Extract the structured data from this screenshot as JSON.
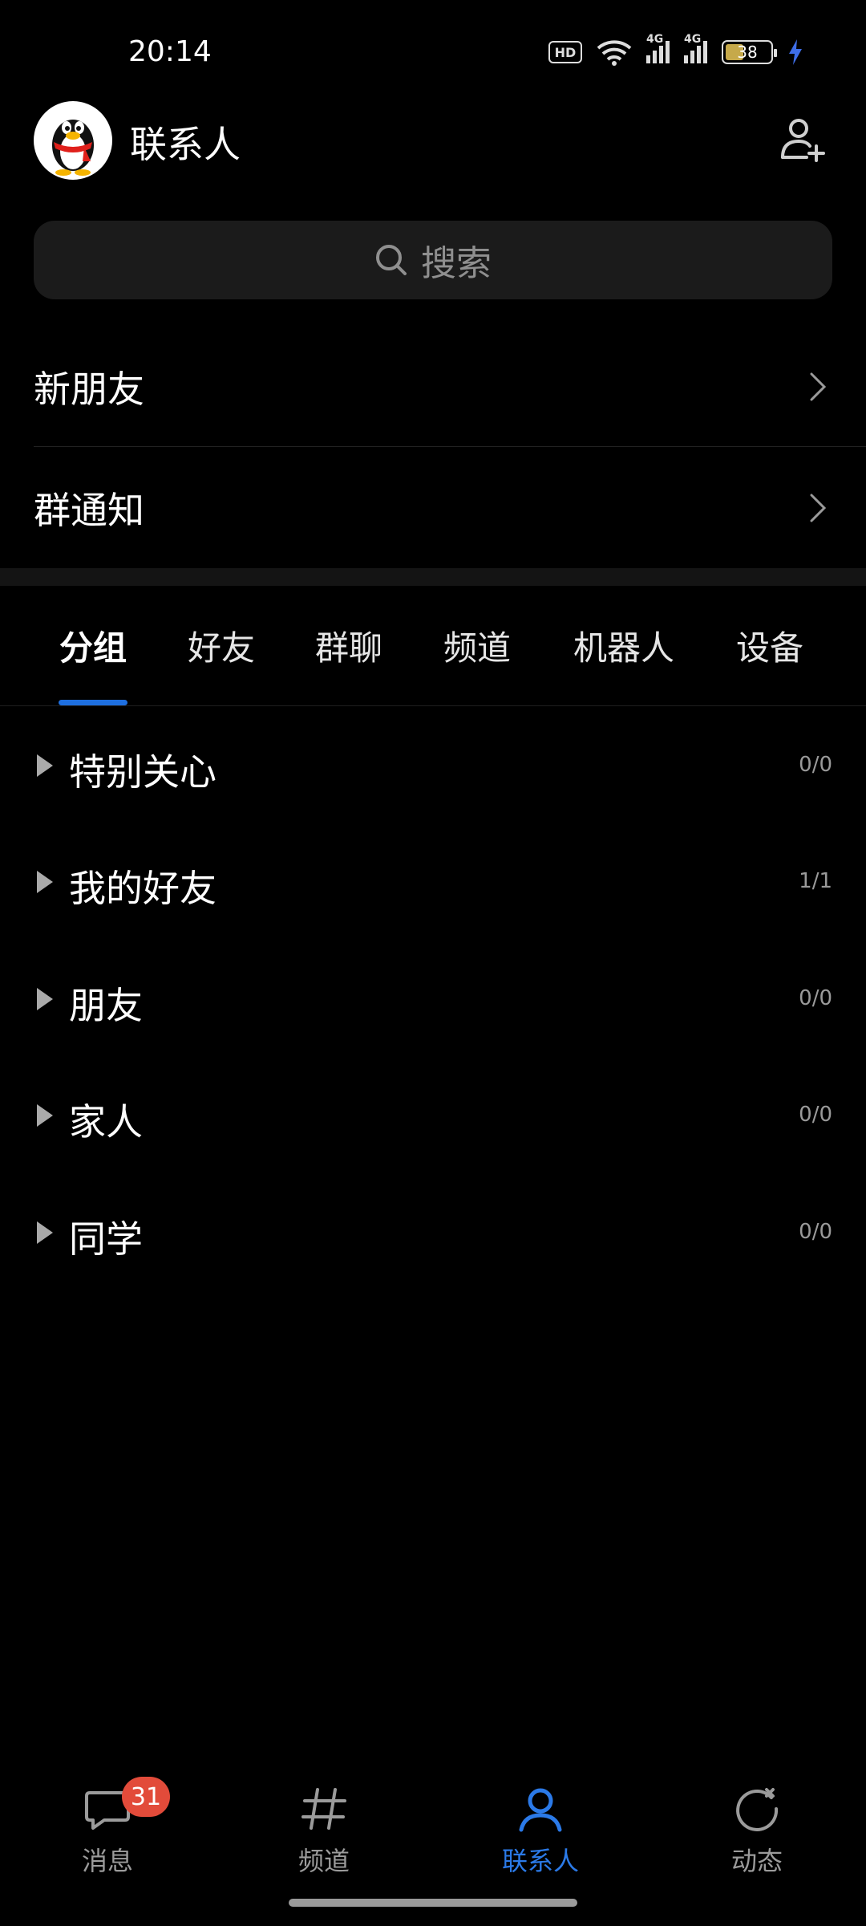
{
  "status_bar": {
    "time": "20:14",
    "hd_label": "HD",
    "network_label_1": "4G",
    "network_label_2": "4G",
    "battery": "38"
  },
  "header": {
    "title": "联系人"
  },
  "search": {
    "placeholder": "搜索"
  },
  "menu": {
    "new_friends": "新朋友",
    "group_notice": "群通知"
  },
  "tabs": [
    {
      "label": "分组",
      "active": true
    },
    {
      "label": "好友",
      "active": false
    },
    {
      "label": "群聊",
      "active": false
    },
    {
      "label": "频道",
      "active": false
    },
    {
      "label": "机器人",
      "active": false
    },
    {
      "label": "设备",
      "active": false
    }
  ],
  "groups": [
    {
      "name": "特别关心",
      "count": "0/0"
    },
    {
      "name": "我的好友",
      "count": "1/1"
    },
    {
      "name": "朋友",
      "count": "0/0"
    },
    {
      "name": "家人",
      "count": "0/0"
    },
    {
      "name": "同学",
      "count": "0/0"
    }
  ],
  "bottom_nav": [
    {
      "label": "消息",
      "icon": "message-icon",
      "badge": "31"
    },
    {
      "label": "频道",
      "icon": "channel-icon"
    },
    {
      "label": "联系人",
      "icon": "contacts-icon",
      "active": true
    },
    {
      "label": "动态",
      "icon": "moments-icon"
    }
  ],
  "colors": {
    "accent": "#1e6fe0",
    "badge": "#e24b3a",
    "background": "#000000"
  }
}
